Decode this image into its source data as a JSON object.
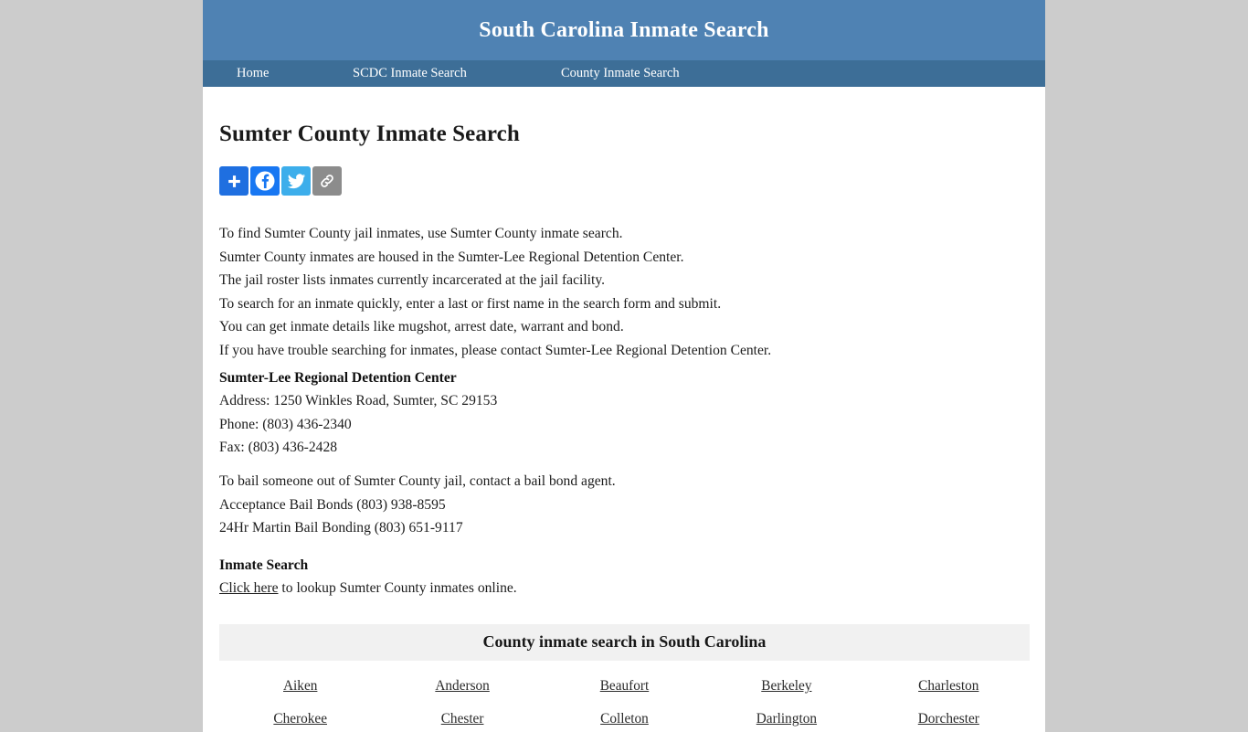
{
  "site": {
    "banner_title": "South Carolina Inmate Search",
    "banner_color": "#4f82b3",
    "nav_color": "#3d6e97",
    "page_background": "#cccccc",
    "content_background": "#ffffff"
  },
  "nav": {
    "home": "Home",
    "scdc": "SCDC Inmate Search",
    "county": "County Inmate Search"
  },
  "page": {
    "heading": "Sumter County Inmate Search"
  },
  "share": {
    "addthis_label": "Share",
    "facebook_label": "Facebook",
    "twitter_label": "Twitter",
    "link_label": "Copy Link",
    "colors": {
      "addthis": "#1f6fe0",
      "facebook": "#1877f2",
      "twitter": "#3daeeb",
      "link": "#8c8c8c"
    }
  },
  "intro": {
    "line1": "To find Sumter County jail inmates, use Sumter County inmate search.",
    "line2": "Sumter County inmates are housed in the Sumter-Lee Regional Detention Center.",
    "line3": "The jail roster lists inmates currently incarcerated at the jail facility.",
    "line4": "To search for an inmate quickly, enter a last or first name in the search form and submit.",
    "line5": "You can get inmate details like mugshot, arrest date, warrant and bond.",
    "line6": "If you have trouble searching for inmates, please contact Sumter-Lee Regional Detention Center."
  },
  "facility": {
    "name": "Sumter-Lee Regional Detention Center",
    "address": "Address: 1250 Winkles Road, Sumter, SC 29153",
    "phone": "Phone: (803) 436-2340",
    "fax": "Fax: (803) 436-2428"
  },
  "bail": {
    "intro": "To bail someone out of Sumter County jail, contact a bail bond agent.",
    "agent1": "Acceptance Bail Bonds (803) 938-8595",
    "agent2": "24Hr Martin Bail Bonding (803) 651-9117"
  },
  "inmate_search": {
    "heading": "Inmate Search",
    "link_text": "Click here",
    "link_suffix": " to lookup Sumter County inmates online."
  },
  "county_table": {
    "title": "County inmate search in South Carolina",
    "counties": [
      "Aiken",
      "Anderson",
      "Beaufort",
      "Berkeley",
      "Charleston",
      "Cherokee",
      "Chester",
      "Colleton",
      "Darlington",
      "Dorchester"
    ]
  }
}
